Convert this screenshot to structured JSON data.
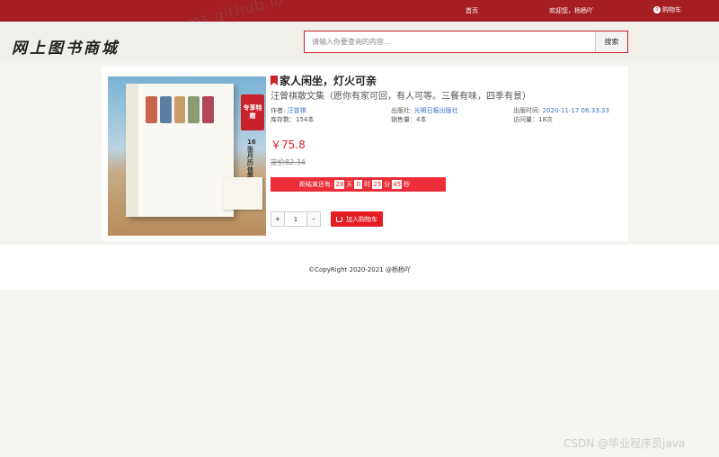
{
  "topbar": {
    "home": "首页",
    "welcome": "欢迎您，杨杨吖",
    "cart_count": "0",
    "cart_label": "购物车"
  },
  "watermark": "Jeeyms.github.io",
  "header": {
    "logo": "网上图书商城",
    "search_placeholder": "请输入你要查询的内容...",
    "search_button": "搜索"
  },
  "book": {
    "cover": {
      "tag": "专享特赠",
      "calendar": "16张月历信笺"
    },
    "title": "家人闲坐，灯火可亲",
    "subtitle": "汪曾祺散文集（愿你有家可回，有人可等。三餐有味，四季有景）",
    "author_label": "作者:",
    "author": "汪曾祺",
    "publisher_label": "出版社:",
    "publisher": "光明日报出版社",
    "pubtime_label": "出版时间:",
    "pubtime": "2020-11-17 06:33:33",
    "stock": "库存数：154本",
    "sales": "销售量：4本",
    "visits": "访问量：18次",
    "price": "￥75.8",
    "original_price": "定价82.34",
    "countdown": {
      "label": "距结束还有:",
      "days": "28",
      "days_unit": "天",
      "hours": "0",
      "hours_unit": "时",
      "minutes": "25",
      "minutes_unit": "分",
      "seconds": "45",
      "seconds_unit": "秒"
    },
    "quantity": "1",
    "minus": "-",
    "plus": "+",
    "add_to_cart": "加入购物车"
  },
  "footer": {
    "copyright": "©CopyRight 2020-2021 @杨杨吖"
  },
  "corner_watermark": "CSDN @毕业程序员java",
  "colors": {
    "brand_red": "#a51e22",
    "accent_red": "#e41d25",
    "link_blue": "#3b6fc4"
  }
}
